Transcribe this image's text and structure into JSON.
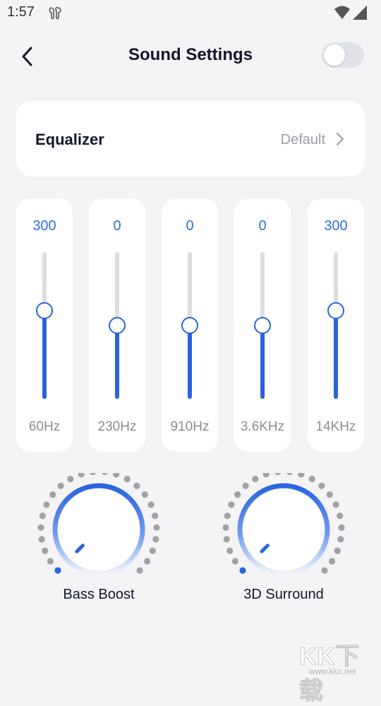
{
  "status_bar": {
    "time": "1:57"
  },
  "header": {
    "title": "Sound Settings",
    "master_toggle_on": false
  },
  "equalizer": {
    "label": "Equalizer",
    "preset": "Default"
  },
  "bands": [
    {
      "value": "300",
      "label": "60Hz",
      "level": 0.6
    },
    {
      "value": "0",
      "label": "230Hz",
      "level": 0.5
    },
    {
      "value": "0",
      "label": "910Hz",
      "level": 0.5
    },
    {
      "value": "0",
      "label": "3.6KHz",
      "level": 0.5
    },
    {
      "value": "300",
      "label": "14KHz",
      "level": 0.6
    }
  ],
  "knobs": [
    {
      "label": "Bass Boost",
      "level": 0.0
    },
    {
      "label": "3D Surround",
      "level": 0.0
    }
  ],
  "watermark": {
    "logo": "KK下载",
    "url": "www.kkx.net"
  },
  "colors": {
    "accent": "#2a63dd",
    "value_text": "#2f6fde",
    "background": "#f4f4f7",
    "card": "#ffffff",
    "track": "#dedede"
  }
}
